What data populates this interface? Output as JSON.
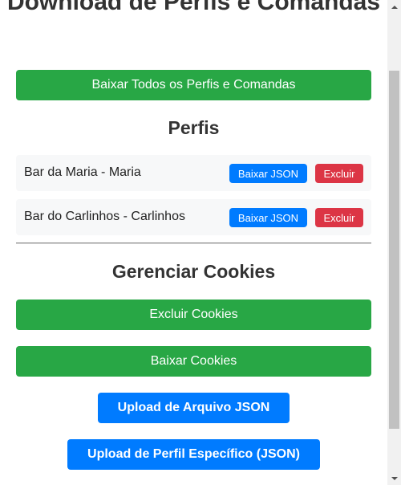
{
  "page": {
    "title": "Download de Perfis e Comandas",
    "download_all_label": "Baixar Todos os Perfis e Comandas"
  },
  "profiles": {
    "heading": "Perfis",
    "items": [
      {
        "name": "Bar da Maria - Maria",
        "json_label": "Baixar JSON",
        "delete_label": "Excluir"
      },
      {
        "name": "Bar do Carlinhos - Carlinhos",
        "json_label": "Baixar JSON",
        "delete_label": "Excluir"
      }
    ]
  },
  "cookies": {
    "heading": "Gerenciar Cookies",
    "delete_label": "Excluir Cookies",
    "download_label": "Baixar Cookies",
    "upload_json_label": "Upload de Arquivo JSON",
    "upload_profile_label": "Upload de Perfil Específico (JSON)"
  },
  "colors": {
    "green": "#28a745",
    "blue": "#007bff",
    "red": "#dc3545",
    "text": "#333333"
  },
  "icons": {
    "scroll_up": "triangle-up",
    "scroll_down": "triangle-down"
  }
}
